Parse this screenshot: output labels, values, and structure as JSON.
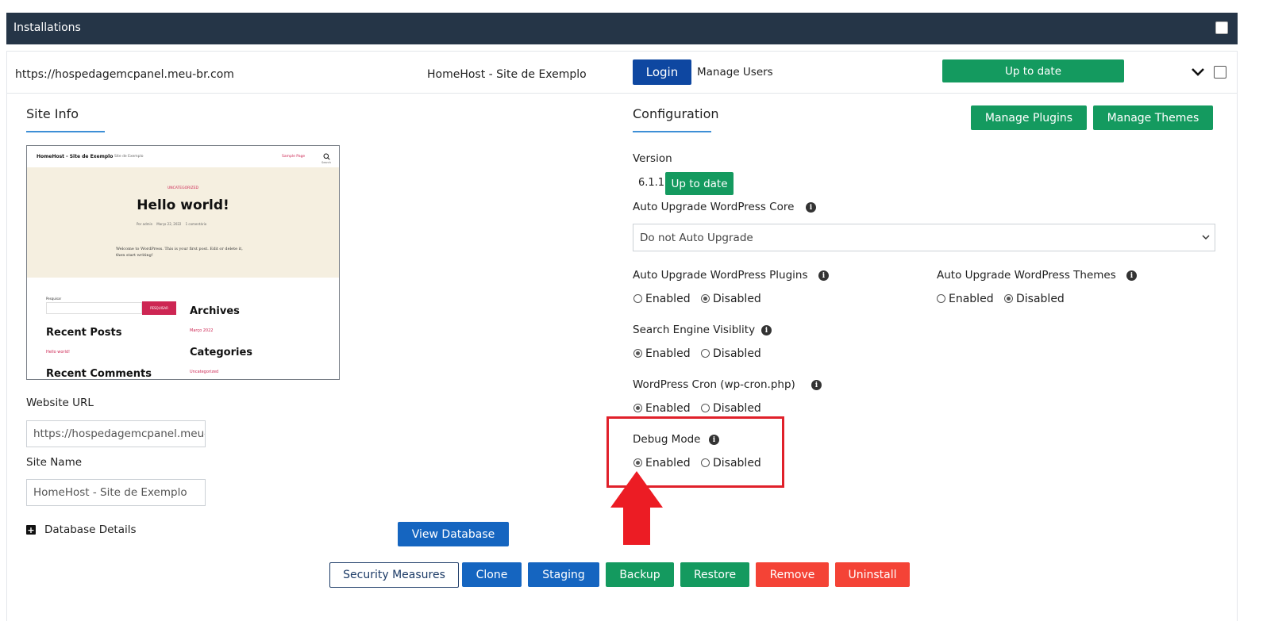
{
  "header": {
    "title": "Installations"
  },
  "installation": {
    "url": "https://hospedagemcpanel.meu-br.com",
    "site_name": "HomeHost - Site de Exemplo",
    "login_label": "Login",
    "manage_users_label": "Manage Users",
    "status_label": "Up to date"
  },
  "site_info": {
    "title": "Site Info",
    "preview": {
      "site_title": "HomeHost - Site de Exemplo",
      "tagline": "Site de Exemplo",
      "nav_link": "Sample Page",
      "search_label": "Search",
      "category": "UNCATEGORIZED",
      "post_title": "Hello world!",
      "meta_author": "Por admin",
      "meta_date": "Março 22, 2022",
      "meta_comments": "1 comentário",
      "excerpt": "Welcome to WordPress. This is your first post. Edit or delete it, then start writing!",
      "search_widget_label": "Pesquisar",
      "search_button": "PESQUISAR",
      "recent_posts": "Recent Posts",
      "recent_post_item": "Hello world!",
      "recent_comments": "Recent Comments",
      "archives": "Archives",
      "archive_item": "Março 2022",
      "categories": "Categories",
      "category_item": "Uncategorized"
    },
    "website_url_label": "Website URL",
    "website_url_value": "https://hospedagemcpanel.meu-br.com",
    "site_name_label": "Site Name",
    "site_name_value": "HomeHost - Site de Exemplo",
    "database_details_label": "Database Details",
    "view_database_label": "View Database"
  },
  "configuration": {
    "title": "Configuration",
    "manage_plugins_label": "Manage Plugins",
    "manage_themes_label": "Manage Themes",
    "version_label": "Version",
    "version_value": "6.1.1",
    "version_status": "Up to date",
    "auto_upgrade_core_label": "Auto Upgrade WordPress Core",
    "auto_upgrade_core_value": "Do not Auto Upgrade",
    "auto_upgrade_plugins_label": "Auto Upgrade WordPress Plugins",
    "auto_upgrade_themes_label": "Auto Upgrade WordPress Themes",
    "search_engine_label": "Search Engine Visiblity",
    "cron_label": "WordPress Cron (wp-cron.php)",
    "debug_label": "Debug Mode",
    "enabled_label": "Enabled",
    "disabled_label": "Disabled"
  },
  "actions": {
    "security": "Security Measures",
    "clone": "Clone",
    "staging": "Staging",
    "backup": "Backup",
    "restore": "Restore",
    "remove": "Remove",
    "uninstall": "Uninstall"
  },
  "colors": {
    "header_bg": "#253547",
    "login_blue": "#0e47a1",
    "action_blue": "#1565c0",
    "green": "#149a5f",
    "red": "#f44336",
    "highlight_red": "#e0202a"
  }
}
